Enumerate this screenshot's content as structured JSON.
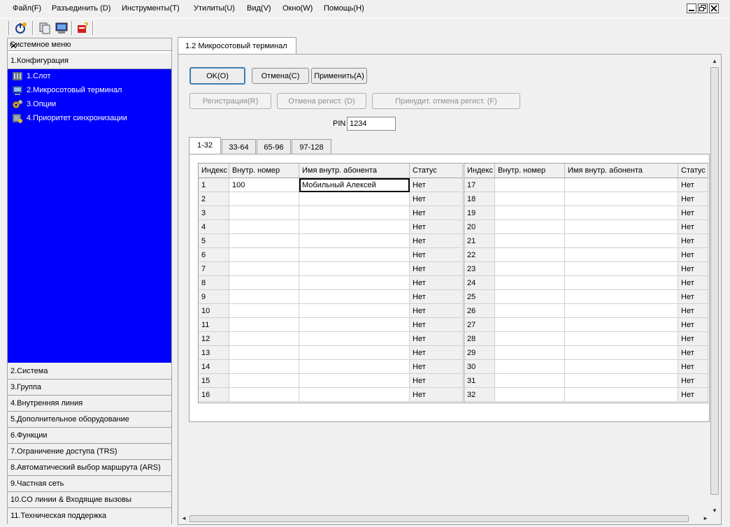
{
  "menubar": {
    "items": [
      "Файл(F)",
      "Разъединить (D)",
      "Инструменты(T)",
      "Утилиты(U)",
      "Вид(V)",
      "Окно(W)",
      "Помощь(H)"
    ]
  },
  "left_panel": {
    "title": "Системное меню",
    "close_glyph": "✕",
    "top_category": "1.Конфигурация",
    "tree_items": [
      "1.Слот",
      "2.Микросотовый терминал",
      "3.Опции",
      "4.Приоритет синхронизации"
    ],
    "bottom_categories": [
      "2.Система",
      "3.Группа",
      "4.Внутренняя линия",
      "5.Дополнительное оборудование",
      "6.Функции",
      "7.Ограничение доступа (TRS)",
      "8.Автоматический выбор маршрута (ARS)",
      "9.Частная сеть",
      "10.CO линии & Входящие вызовы",
      "11.Техническая поддержка"
    ]
  },
  "main": {
    "tab_label": "1.2 Микросотовый терминал",
    "buttons": {
      "ok": "OK(O)",
      "cancel": "Отмена(C)",
      "apply": "Применить(A)",
      "register": "Регистрация(R)",
      "unregister": "Отмена регист. (D)",
      "force_unregister": "Принудит. отмена регист. (F)"
    },
    "pin_label": "PIN",
    "pin_value": "1234",
    "sub_tabs": [
      "1-32",
      "33-64",
      "65-96",
      "97-128"
    ],
    "columns": [
      "Индекс",
      "Внутр. номер",
      "Имя внутр. абонента",
      "Статус"
    ],
    "left_rows": [
      {
        "index": "1",
        "ext": "100",
        "name": "Мобильный Алексей",
        "status": "Нет"
      },
      {
        "index": "2",
        "ext": "",
        "name": "",
        "status": "Нет"
      },
      {
        "index": "3",
        "ext": "",
        "name": "",
        "status": "Нет"
      },
      {
        "index": "4",
        "ext": "",
        "name": "",
        "status": "Нет"
      },
      {
        "index": "5",
        "ext": "",
        "name": "",
        "status": "Нет"
      },
      {
        "index": "6",
        "ext": "",
        "name": "",
        "status": "Нет"
      },
      {
        "index": "7",
        "ext": "",
        "name": "",
        "status": "Нет"
      },
      {
        "index": "8",
        "ext": "",
        "name": "",
        "status": "Нет"
      },
      {
        "index": "9",
        "ext": "",
        "name": "",
        "status": "Нет"
      },
      {
        "index": "10",
        "ext": "",
        "name": "",
        "status": "Нет"
      },
      {
        "index": "11",
        "ext": "",
        "name": "",
        "status": "Нет"
      },
      {
        "index": "12",
        "ext": "",
        "name": "",
        "status": "Нет"
      },
      {
        "index": "13",
        "ext": "",
        "name": "",
        "status": "Нет"
      },
      {
        "index": "14",
        "ext": "",
        "name": "",
        "status": "Нет"
      },
      {
        "index": "15",
        "ext": "",
        "name": "",
        "status": "Нет"
      },
      {
        "index": "16",
        "ext": "",
        "name": "",
        "status": "Нет"
      }
    ],
    "right_rows": [
      {
        "index": "17",
        "ext": "",
        "name": "",
        "status": "Нет"
      },
      {
        "index": "18",
        "ext": "",
        "name": "",
        "status": "Нет"
      },
      {
        "index": "19",
        "ext": "",
        "name": "",
        "status": "Нет"
      },
      {
        "index": "20",
        "ext": "",
        "name": "",
        "status": "Нет"
      },
      {
        "index": "21",
        "ext": "",
        "name": "",
        "status": "Нет"
      },
      {
        "index": "22",
        "ext": "",
        "name": "",
        "status": "Нет"
      },
      {
        "index": "23",
        "ext": "",
        "name": "",
        "status": "Нет"
      },
      {
        "index": "24",
        "ext": "",
        "name": "",
        "status": "Нет"
      },
      {
        "index": "25",
        "ext": "",
        "name": "",
        "status": "Нет"
      },
      {
        "index": "26",
        "ext": "",
        "name": "",
        "status": "Нет"
      },
      {
        "index": "27",
        "ext": "",
        "name": "",
        "status": "Нет"
      },
      {
        "index": "28",
        "ext": "",
        "name": "",
        "status": "Нет"
      },
      {
        "index": "29",
        "ext": "",
        "name": "",
        "status": "Нет"
      },
      {
        "index": "30",
        "ext": "",
        "name": "",
        "status": "Нет"
      },
      {
        "index": "31",
        "ext": "",
        "name": "",
        "status": "Нет"
      },
      {
        "index": "32",
        "ext": "",
        "name": "",
        "status": "Нет"
      }
    ]
  },
  "colors": {
    "tree_background": "#0000ff",
    "tree_text": "#ffffff",
    "default_button_border": "#3c7fb1"
  },
  "icons": {
    "toolbar": [
      "connect-icon",
      "copy-icon",
      "terminal-icon",
      "help-icon"
    ],
    "tree": [
      "slot-icon",
      "micro-terminal-icon",
      "options-icon",
      "sync-priority-icon"
    ],
    "window_controls": [
      "minimize-icon",
      "restore-icon",
      "close-icon"
    ]
  }
}
